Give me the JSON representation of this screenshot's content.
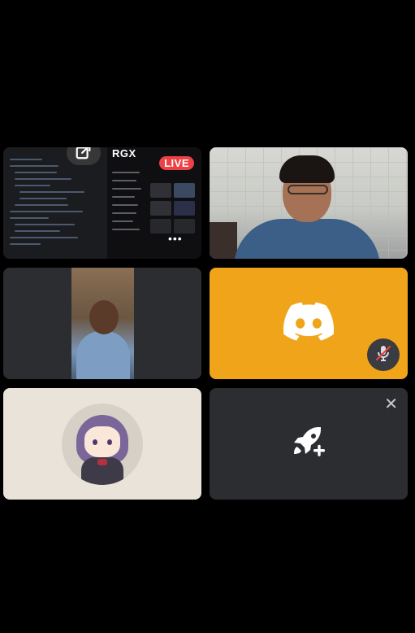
{
  "call": {
    "tiles": [
      {
        "type": "screen-share",
        "badge": "LIVE",
        "stream_brand": "RGX",
        "more": "•••"
      },
      {
        "type": "webcam"
      },
      {
        "type": "webcam-vertical"
      },
      {
        "type": "avatar-muted",
        "avatar_icon": "discord-logo-icon",
        "status_icon": "mic-muted-icon"
      },
      {
        "type": "avatar"
      },
      {
        "type": "activity-launcher",
        "icon": "rocket-add-icon",
        "close": "✕"
      }
    ]
  },
  "colors": {
    "background": "#000000",
    "tile_bg": "#2b2d31",
    "live_red": "#ed4245",
    "avatar_orange": "#f0a419"
  }
}
